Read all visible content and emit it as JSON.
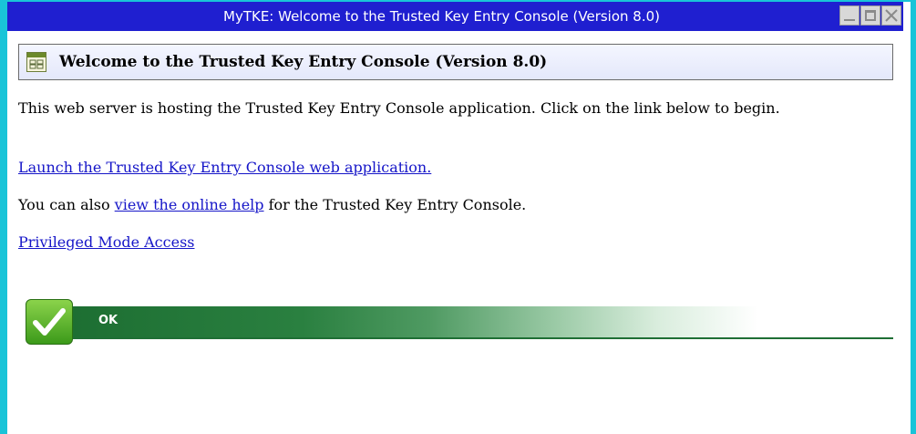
{
  "window": {
    "title": "MyTKE: Welcome to the Trusted Key Entry Console (Version 8.0)"
  },
  "header": {
    "title": "Welcome to the Trusted Key Entry Console (Version 8.0)",
    "icon": "application-window-icon"
  },
  "body": {
    "intro": "This web server is hosting the Trusted Key Entry Console application.  Click on the link below to begin.",
    "launch_link": "Launch the Trusted Key Entry Console web application.",
    "help_prefix": "You can also ",
    "help_link": "view the online help",
    "help_suffix": " for the Trusted Key Entry Console.",
    "privileged_link": "Privileged Mode Access"
  },
  "status": {
    "text": "OK",
    "icon": "checkmark-icon"
  },
  "colors": {
    "titlebar": "#1f1fd0",
    "window_border": "#19c4d8",
    "link": "#1515c8",
    "status_green": "#1c6d31"
  }
}
